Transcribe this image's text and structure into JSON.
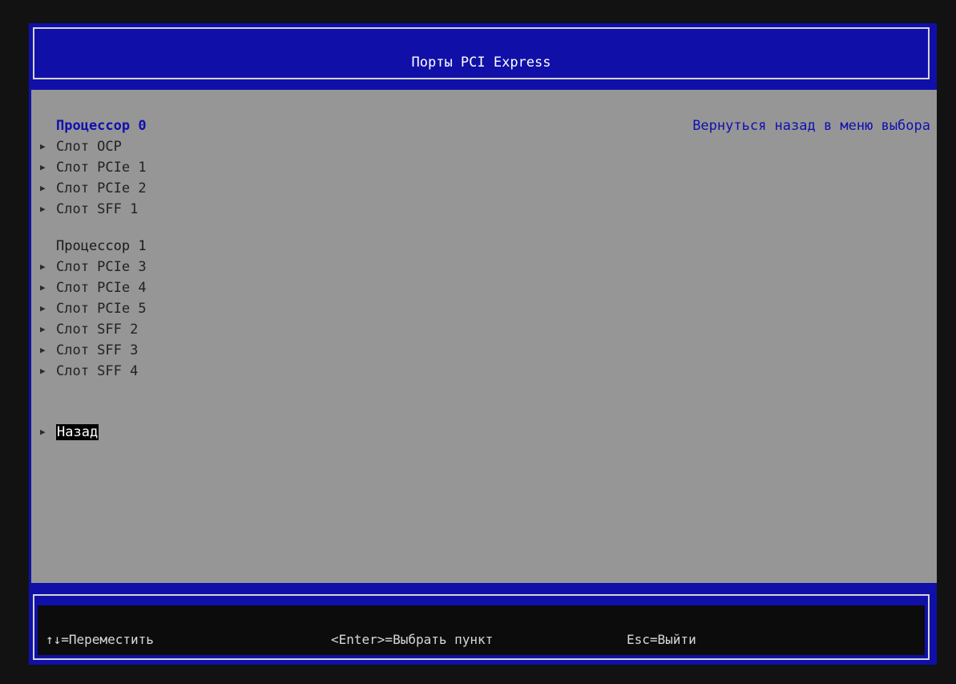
{
  "header": {
    "title": "Порты PCI Express"
  },
  "help": {
    "text": "Вернуться назад в меню выбора"
  },
  "menu": {
    "cpu0_heading": "Процессор 0",
    "cpu0_items": [
      "Слот OCP",
      "Слот PCIe 1",
      "Слот PCIe 2",
      "Слот SFF 1"
    ],
    "cpu1_heading": "Процессор 1",
    "cpu1_items": [
      "Слот PCIe 3",
      "Слот PCIe 4",
      "Слот PCIe 5",
      "Слот SFF 2",
      "Слот SFF 3",
      "Слот SFF 4"
    ],
    "back_label": "Назад"
  },
  "footer": {
    "move": "↑↓=Переместить",
    "select": "<Enter>=Выбрать пункт",
    "exit": "Esc=Выйти"
  },
  "colors": {
    "frame_blue": "#1010a8",
    "body_gray": "#969696",
    "highlight_blue": "#1010b0",
    "footer_black": "#0c0c0c"
  },
  "icons": {
    "submenu_arrow": "triangle-right-icon"
  }
}
